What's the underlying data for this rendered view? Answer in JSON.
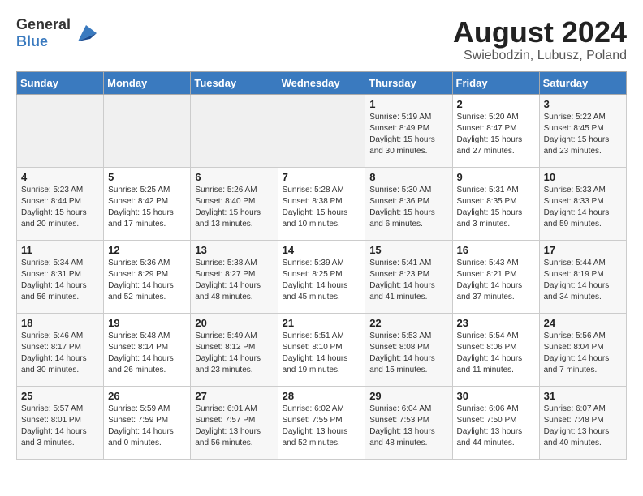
{
  "header": {
    "logo_general": "General",
    "logo_blue": "Blue",
    "title": "August 2024",
    "subtitle": "Swiebodzin, Lubusz, Poland"
  },
  "weekdays": [
    "Sunday",
    "Monday",
    "Tuesday",
    "Wednesday",
    "Thursday",
    "Friday",
    "Saturday"
  ],
  "weeks": [
    [
      {
        "day": "",
        "info": ""
      },
      {
        "day": "",
        "info": ""
      },
      {
        "day": "",
        "info": ""
      },
      {
        "day": "",
        "info": ""
      },
      {
        "day": "1",
        "info": "Sunrise: 5:19 AM\nSunset: 8:49 PM\nDaylight: 15 hours\nand 30 minutes."
      },
      {
        "day": "2",
        "info": "Sunrise: 5:20 AM\nSunset: 8:47 PM\nDaylight: 15 hours\nand 27 minutes."
      },
      {
        "day": "3",
        "info": "Sunrise: 5:22 AM\nSunset: 8:45 PM\nDaylight: 15 hours\nand 23 minutes."
      }
    ],
    [
      {
        "day": "4",
        "info": "Sunrise: 5:23 AM\nSunset: 8:44 PM\nDaylight: 15 hours\nand 20 minutes."
      },
      {
        "day": "5",
        "info": "Sunrise: 5:25 AM\nSunset: 8:42 PM\nDaylight: 15 hours\nand 17 minutes."
      },
      {
        "day": "6",
        "info": "Sunrise: 5:26 AM\nSunset: 8:40 PM\nDaylight: 15 hours\nand 13 minutes."
      },
      {
        "day": "7",
        "info": "Sunrise: 5:28 AM\nSunset: 8:38 PM\nDaylight: 15 hours\nand 10 minutes."
      },
      {
        "day": "8",
        "info": "Sunrise: 5:30 AM\nSunset: 8:36 PM\nDaylight: 15 hours\nand 6 minutes."
      },
      {
        "day": "9",
        "info": "Sunrise: 5:31 AM\nSunset: 8:35 PM\nDaylight: 15 hours\nand 3 minutes."
      },
      {
        "day": "10",
        "info": "Sunrise: 5:33 AM\nSunset: 8:33 PM\nDaylight: 14 hours\nand 59 minutes."
      }
    ],
    [
      {
        "day": "11",
        "info": "Sunrise: 5:34 AM\nSunset: 8:31 PM\nDaylight: 14 hours\nand 56 minutes."
      },
      {
        "day": "12",
        "info": "Sunrise: 5:36 AM\nSunset: 8:29 PM\nDaylight: 14 hours\nand 52 minutes."
      },
      {
        "day": "13",
        "info": "Sunrise: 5:38 AM\nSunset: 8:27 PM\nDaylight: 14 hours\nand 48 minutes."
      },
      {
        "day": "14",
        "info": "Sunrise: 5:39 AM\nSunset: 8:25 PM\nDaylight: 14 hours\nand 45 minutes."
      },
      {
        "day": "15",
        "info": "Sunrise: 5:41 AM\nSunset: 8:23 PM\nDaylight: 14 hours\nand 41 minutes."
      },
      {
        "day": "16",
        "info": "Sunrise: 5:43 AM\nSunset: 8:21 PM\nDaylight: 14 hours\nand 37 minutes."
      },
      {
        "day": "17",
        "info": "Sunrise: 5:44 AM\nSunset: 8:19 PM\nDaylight: 14 hours\nand 34 minutes."
      }
    ],
    [
      {
        "day": "18",
        "info": "Sunrise: 5:46 AM\nSunset: 8:17 PM\nDaylight: 14 hours\nand 30 minutes."
      },
      {
        "day": "19",
        "info": "Sunrise: 5:48 AM\nSunset: 8:14 PM\nDaylight: 14 hours\nand 26 minutes."
      },
      {
        "day": "20",
        "info": "Sunrise: 5:49 AM\nSunset: 8:12 PM\nDaylight: 14 hours\nand 23 minutes."
      },
      {
        "day": "21",
        "info": "Sunrise: 5:51 AM\nSunset: 8:10 PM\nDaylight: 14 hours\nand 19 minutes."
      },
      {
        "day": "22",
        "info": "Sunrise: 5:53 AM\nSunset: 8:08 PM\nDaylight: 14 hours\nand 15 minutes."
      },
      {
        "day": "23",
        "info": "Sunrise: 5:54 AM\nSunset: 8:06 PM\nDaylight: 14 hours\nand 11 minutes."
      },
      {
        "day": "24",
        "info": "Sunrise: 5:56 AM\nSunset: 8:04 PM\nDaylight: 14 hours\nand 7 minutes."
      }
    ],
    [
      {
        "day": "25",
        "info": "Sunrise: 5:57 AM\nSunset: 8:01 PM\nDaylight: 14 hours\nand 3 minutes."
      },
      {
        "day": "26",
        "info": "Sunrise: 5:59 AM\nSunset: 7:59 PM\nDaylight: 14 hours\nand 0 minutes."
      },
      {
        "day": "27",
        "info": "Sunrise: 6:01 AM\nSunset: 7:57 PM\nDaylight: 13 hours\nand 56 minutes."
      },
      {
        "day": "28",
        "info": "Sunrise: 6:02 AM\nSunset: 7:55 PM\nDaylight: 13 hours\nand 52 minutes."
      },
      {
        "day": "29",
        "info": "Sunrise: 6:04 AM\nSunset: 7:53 PM\nDaylight: 13 hours\nand 48 minutes."
      },
      {
        "day": "30",
        "info": "Sunrise: 6:06 AM\nSunset: 7:50 PM\nDaylight: 13 hours\nand 44 minutes."
      },
      {
        "day": "31",
        "info": "Sunrise: 6:07 AM\nSunset: 7:48 PM\nDaylight: 13 hours\nand 40 minutes."
      }
    ]
  ]
}
